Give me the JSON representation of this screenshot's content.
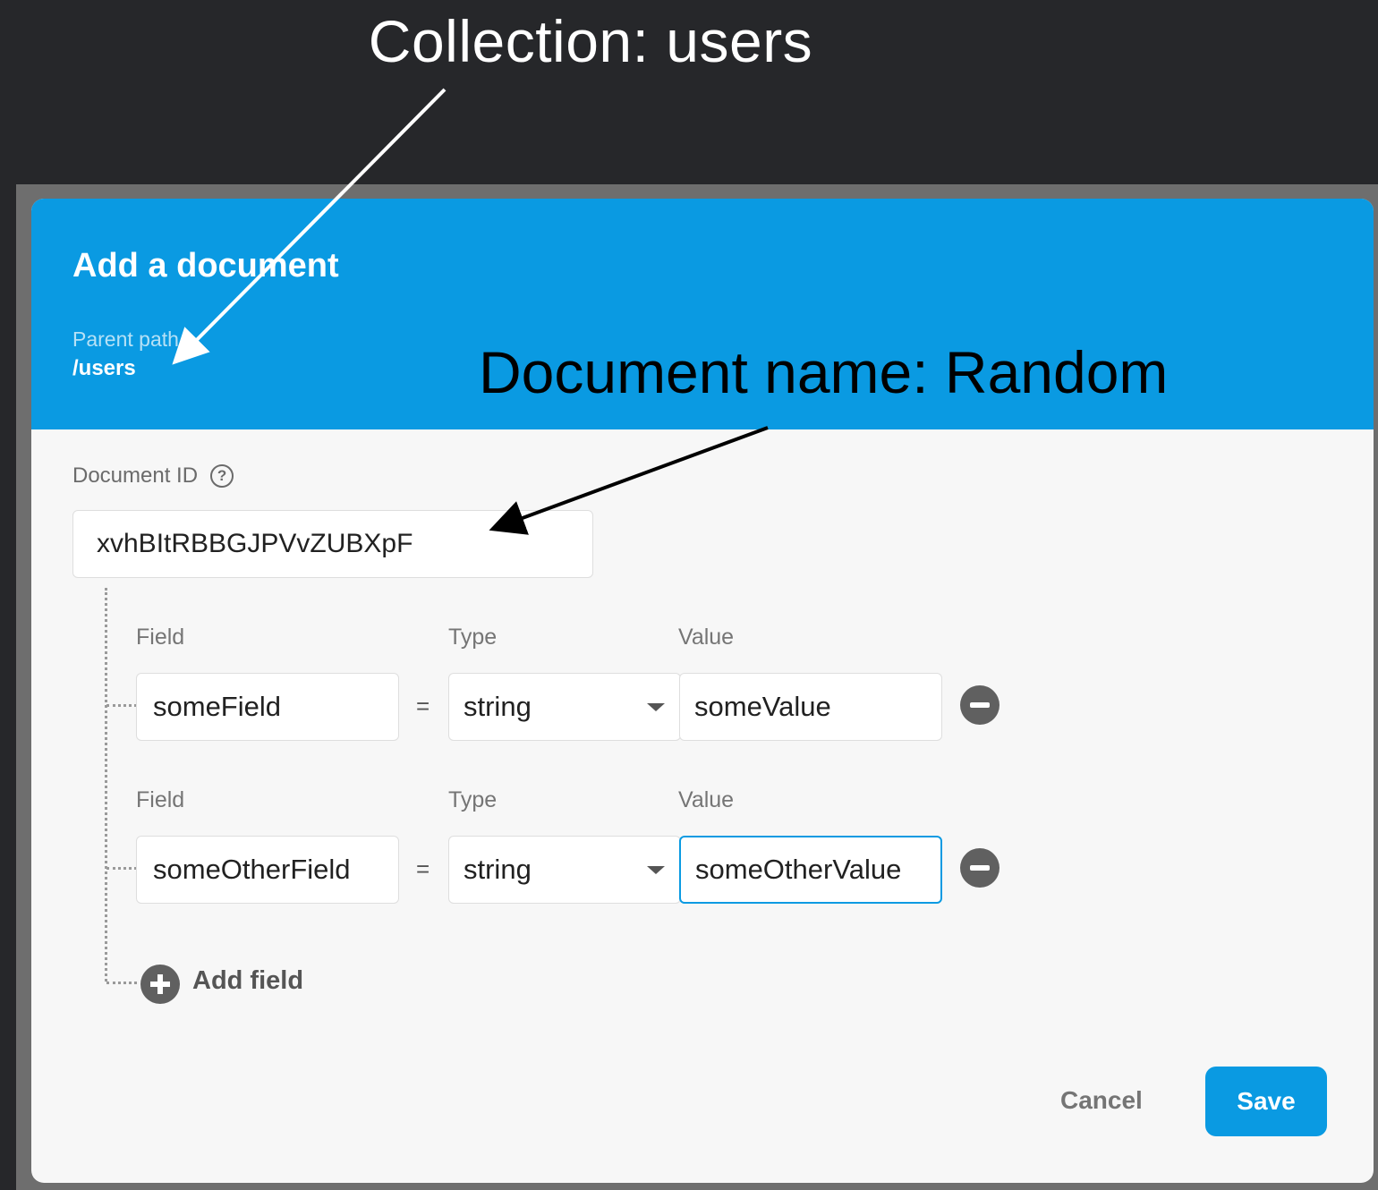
{
  "annotations": {
    "collection": "Collection: users",
    "document_name": "Document name: Random"
  },
  "dialog": {
    "title": "Add a document",
    "parent_path_label": "Parent path",
    "parent_path_value": "/users",
    "document_id_label": "Document ID",
    "help_glyph": "?",
    "document_id_value": "xvhBItRBBGJPVvZUBXpF",
    "rows": [
      {
        "field_label": "Field",
        "type_label": "Type",
        "value_label": "Value",
        "field": "someField",
        "equals": "=",
        "type": "string",
        "value": "someValue"
      },
      {
        "field_label": "Field",
        "type_label": "Type",
        "value_label": "Value",
        "field": "someOtherField",
        "equals": "=",
        "type": "string",
        "value": "someOtherValue"
      }
    ],
    "add_field_label": "Add field",
    "cancel_label": "Cancel",
    "save_label": "Save"
  },
  "colors": {
    "header_blue": "#0a9ae2",
    "page_background": "#26272a",
    "dialog_background": "#f7f7f7"
  },
  "icons": [
    "help-icon",
    "remove-field-icon",
    "add-field-icon",
    "dropdown-caret-icon"
  ]
}
